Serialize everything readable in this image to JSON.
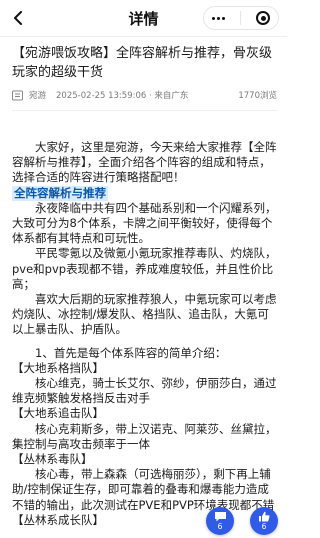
{
  "header": {
    "title": "详情",
    "more_icon": "more-dots-icon",
    "close_icon": "target-close-icon"
  },
  "article": {
    "title": "【宛游喂饭攻略】全阵容解析与推荐，骨灰级玩家的超级干货",
    "meta": {
      "author": "宛游",
      "datetime": "2025-02-25 13:59:06 · 来自广东",
      "views": "1770浏览"
    },
    "paragraphs": [
      "大家好，这里是宛游，今天来给大家推荐【全阵容解析与推荐】，全面介绍各个阵容的组成和特点，选择合适的阵容进行策略搭配吧！",
      "全阵容解析与推荐",
      "永夜降临中共有四个基础系别和一个闪耀系列，大致可分为8个体系，卡牌之间平衡较好，使得每个体系都有其特点和可玩性。",
      "平民零氪以及微氪小氪玩家推荐毒队、灼烧队，pve和pvp表现都不错，养成难度较低，并且性价比高；",
      "喜欢大后期的玩家推荐狼人，中氪玩家可以考虑灼烧队、冰控制/爆发队、格挡队、追击队，大氪可以上暴击队、护盾队。",
      "1、首先是每个体系阵容的简单介绍：",
      "【大地系格挡队】",
      "核心维克，骑士长艾尔、弥纱，伊丽莎白，通过维克频繁触发格挡反击对手",
      "【大地系追击队】",
      "核心克莉斯多，带上汉诺克、阿莱莎、丝黛拉，集控制与高攻击频率于一体",
      "【丛林系毒队】",
      "核心毒，带上森森（可选梅丽莎），剩下再上辅助/控制保证生存，即可靠着的叠毒和爆毒能力造成不错的输出，此次测试在PVE和PVP环境表现都不错",
      "【丛林系成长队】"
    ]
  },
  "floating": {
    "comment_count": "6",
    "like_count": "6"
  },
  "colors": {
    "accent": "#2f5be6",
    "highlight_bg": "#d9ecff",
    "highlight_text": "#0a57a8"
  }
}
